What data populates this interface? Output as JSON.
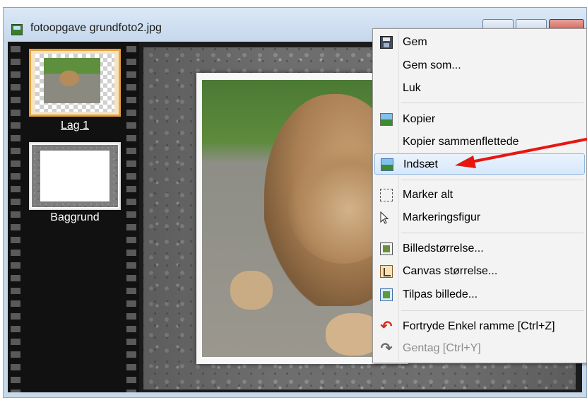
{
  "window": {
    "title": "fotoopgave grundfoto2.jpg"
  },
  "layers": [
    {
      "label": "Lag 1",
      "selected": true
    },
    {
      "label": "Baggrund",
      "selected": false
    }
  ],
  "context_menu": {
    "items": [
      {
        "label": "Gem",
        "icon": "save-icon"
      },
      {
        "label": "Gem som...",
        "icon": null
      },
      {
        "label": "Luk",
        "icon": null
      },
      {
        "label": "Kopier",
        "icon": "image-copy-icon"
      },
      {
        "label": "Kopier sammenflettede",
        "icon": null
      },
      {
        "label": "Indsæt",
        "icon": "image-paste-icon",
        "highlighted": true
      },
      {
        "label": "Marker alt",
        "icon": "select-all-icon"
      },
      {
        "label": "Markeringsfigur",
        "icon": "pointer-icon"
      },
      {
        "label": "Billedstørrelse...",
        "icon": "image-size-icon"
      },
      {
        "label": "Canvas størrelse...",
        "icon": "canvas-size-icon"
      },
      {
        "label": "Tilpas billede...",
        "icon": "fit-image-icon"
      },
      {
        "label": "Fortryde Enkel ramme [Ctrl+Z]",
        "icon": "undo-icon"
      },
      {
        "label": "Gentag [Ctrl+Y]",
        "icon": "redo-icon",
        "disabled": true
      }
    ]
  },
  "colors": {
    "highlight": "#d6e8fb",
    "arrow": "#e8150f",
    "selected_layer_border": "#e8a23a"
  }
}
